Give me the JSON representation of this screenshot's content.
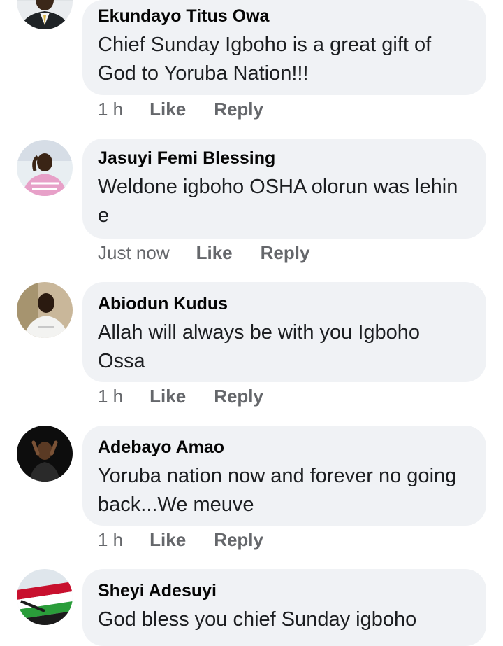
{
  "comments": [
    {
      "author": "Ekundayo Titus Owa",
      "text": "Chief Sunday Igboho is a great gift of God to Yoruba Nation!!!",
      "time": "1 h",
      "like_label": "Like",
      "reply_label": "Reply",
      "avatar_icon": "man-in-suit-avatar"
    },
    {
      "author": "Jasuyi Femi Blessing",
      "text": "Weldone igboho OSHA olorun was lehin e",
      "time": "Just now",
      "like_label": "Like",
      "reply_label": "Reply",
      "avatar_icon": "man-pink-shirt-avatar"
    },
    {
      "author": "Abiodun Kudus",
      "text": "Allah will always be with you Igboho Ossa",
      "time": "1 h",
      "like_label": "Like",
      "reply_label": "Reply",
      "avatar_icon": "man-white-shirt-avatar"
    },
    {
      "author": "Adebayo Amao",
      "text": "Yoruba nation now and forever no going back...We meuve",
      "time": "1 h",
      "like_label": "Like",
      "reply_label": "Reply",
      "avatar_icon": "man-dark-background-avatar"
    },
    {
      "author": "Sheyi Adesuyi",
      "text": "God bless you chief Sunday igboho",
      "time": "",
      "like_label": "",
      "reply_label": "",
      "avatar_icon": "yoruba-nation-flag-avatar"
    }
  ],
  "colors": {
    "bubble": "#f0f2f5",
    "meta": "#65676b",
    "name": "#050505"
  }
}
